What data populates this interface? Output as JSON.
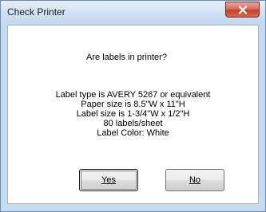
{
  "window": {
    "title": "Check Printer"
  },
  "message": {
    "question": "Are labels in printer?",
    "details": [
      "Label type is AVERY 5267 or equivalent",
      "Paper size is 8.5\"W x 11\"H",
      "Label size is 1-3/4\"W x 1/2\"H",
      "80 labels/sheet",
      "Label Color: White"
    ]
  },
  "buttons": {
    "yes_label": "Yes",
    "no_label": "No"
  },
  "icons": {
    "close": "close-icon"
  },
  "colors": {
    "close_button": "#c4412a",
    "frame": "#c6daf0"
  }
}
